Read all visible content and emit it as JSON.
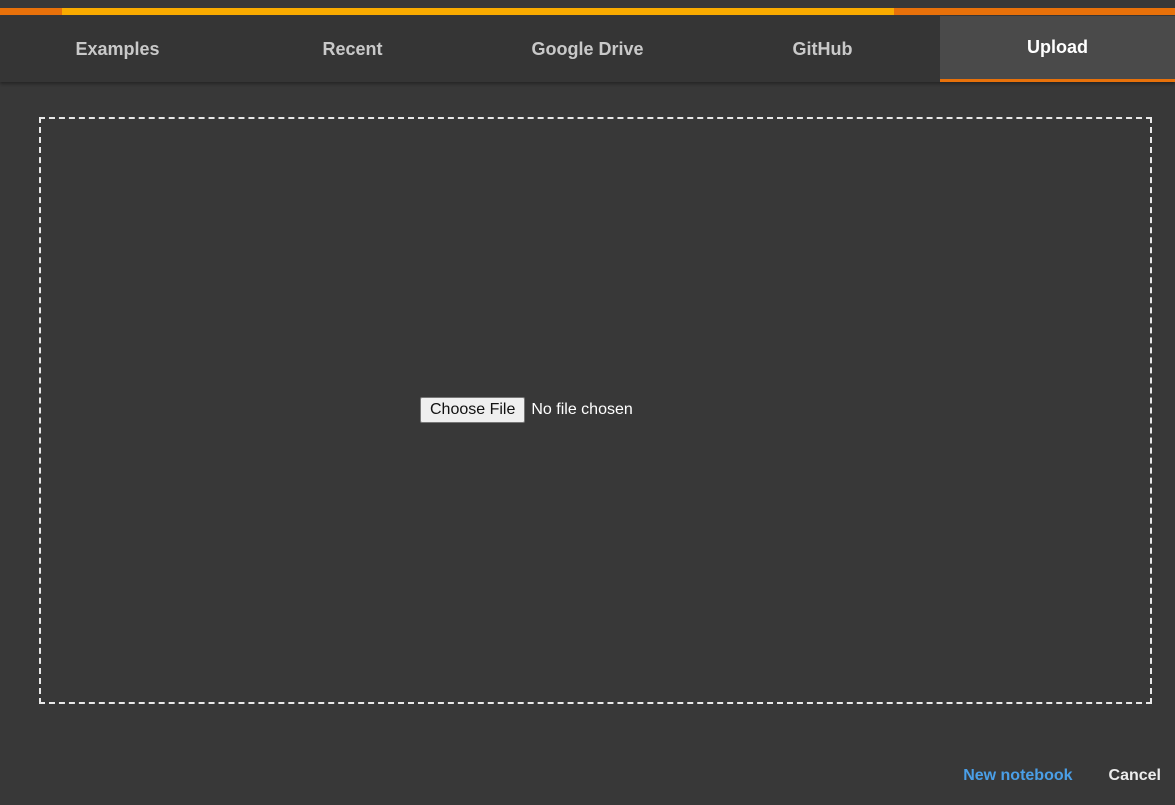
{
  "accent_colors": {
    "orange": "#e8710a",
    "yellow": "#f9ab00",
    "link_blue": "#4a9fe8"
  },
  "tabs": [
    {
      "label": "Examples",
      "active": false
    },
    {
      "label": "Recent",
      "active": false
    },
    {
      "label": "Google Drive",
      "active": false
    },
    {
      "label": "GitHub",
      "active": false
    },
    {
      "label": "Upload",
      "active": true
    }
  ],
  "upload": {
    "choose_file_label": "Choose File",
    "file_status": "No file chosen"
  },
  "footer": {
    "new_notebook_label": "New notebook",
    "cancel_label": "Cancel"
  }
}
